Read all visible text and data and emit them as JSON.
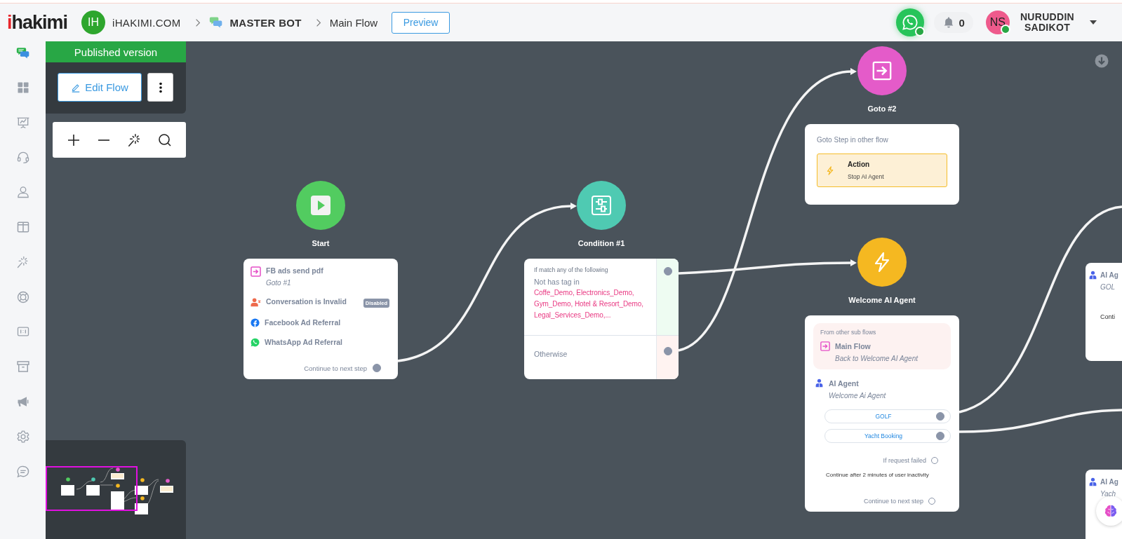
{
  "header": {
    "logo": "ihakimi",
    "workspace": {
      "initials": "IH",
      "name": "iHAKIMI.COM"
    },
    "breadcrumbs": [
      {
        "label": "MASTER BOT",
        "kind": "bot"
      },
      {
        "label": "Main Flow",
        "kind": "page"
      }
    ],
    "preview_button": "Preview",
    "whatsapp": {
      "online": true
    },
    "notifications": "0",
    "user": {
      "initials": "NS",
      "name": "NURUDDIN SADIKOT",
      "online": true
    }
  },
  "sidebar": {
    "items": [
      {
        "kind": "bots",
        "selected": true
      },
      {
        "kind": "dashboard",
        "selected": false
      },
      {
        "kind": "reports",
        "selected": false
      },
      {
        "kind": "support",
        "selected": false
      },
      {
        "kind": "contacts",
        "selected": false
      },
      {
        "kind": "columns",
        "selected": false
      },
      {
        "kind": "magic",
        "selected": false
      },
      {
        "kind": "help",
        "selected": false
      },
      {
        "kind": "counter",
        "selected": false
      },
      {
        "kind": "archive",
        "selected": false
      },
      {
        "kind": "broadcast",
        "selected": false
      },
      {
        "kind": "settings",
        "selected": false
      },
      {
        "kind": "messages",
        "selected": false
      }
    ]
  },
  "flow_panel": {
    "status": "Published version",
    "edit_button": "Edit Flow"
  },
  "nodes": [
    {
      "kind": "start",
      "label": "Start",
      "rows": [
        {
          "kind": "goto",
          "title": "FB ads send pdf",
          "subtitle": "Goto #1"
        },
        {
          "kind": "invalid",
          "title": "Conversation is Invalid",
          "badge": "Disabled"
        },
        {
          "kind": "facebook",
          "title": "Facebook Ad Referral"
        },
        {
          "kind": "whatsapp",
          "title": "WhatsApp Ad Referral"
        }
      ],
      "next": {
        "label": "Continue to next step",
        "connected": true
      }
    },
    {
      "kind": "condition",
      "label": "Condition #1",
      "match": {
        "caption": "If match any of the following",
        "rule": "Not has tag in",
        "tags": "Coffe_Demo, Electronics_Demo, Gym_Demo, Hotel & Resort_Demo, Legal_Services_Demo,...",
        "connected": true
      },
      "otherwise": {
        "label": "Otherwise",
        "connected": true
      }
    },
    {
      "kind": "goto",
      "label": "Goto #2",
      "caption": "Goto Step in other flow",
      "action": {
        "title": "Action",
        "detail": "Stop AI Agent"
      }
    },
    {
      "kind": "action",
      "label": "Welcome AI Agent",
      "from": {
        "caption": "From other sub flows",
        "title": "Main Flow",
        "subtitle": "Back to Welcome AI Agent"
      },
      "agent": {
        "title": "AI Agent",
        "subtitle": "Welcome Ai Agent"
      },
      "options": [
        {
          "label": "GOLF",
          "connected": true
        },
        {
          "label": "Yacht Booking",
          "connected": true
        }
      ],
      "failed": {
        "label": "If request failed",
        "connected": false
      },
      "inactivity": "Continue after 2 minutes of user inactivity",
      "next": {
        "label": "Continue to next step",
        "connected": false
      }
    }
  ],
  "partial_cards": [
    {
      "title": "AI Ag",
      "subtitle": "GOL",
      "footer": "Conti"
    },
    {
      "title": "AI Ag",
      "subtitle": "Yach"
    }
  ]
}
